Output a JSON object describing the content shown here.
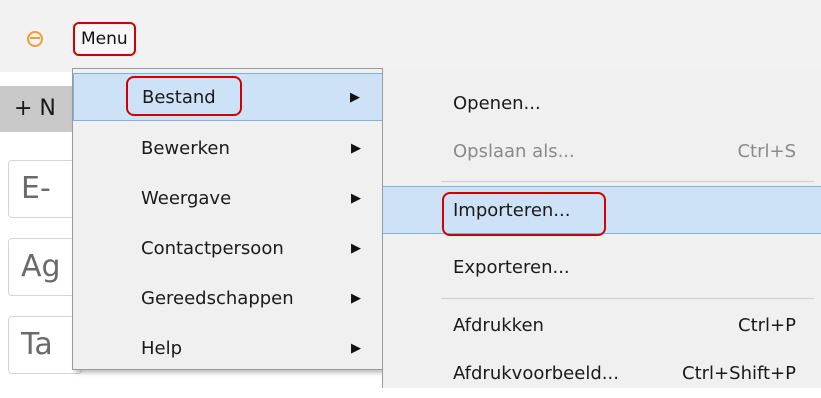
{
  "app": {
    "icon": "mail-app-icon",
    "menu_label": "Menu"
  },
  "toolbar": {
    "new_label": "+ N"
  },
  "sidebar": {
    "tabs": [
      "E-",
      "Ag",
      "Ta"
    ]
  },
  "main_menu": {
    "items": [
      {
        "label": "Bestand",
        "has_submenu": true,
        "selected": true
      },
      {
        "label": "Bewerken",
        "has_submenu": true
      },
      {
        "label": "Weergave",
        "has_submenu": true
      },
      {
        "label": "Contactpersoon",
        "has_submenu": true
      },
      {
        "label": "Gereedschappen",
        "has_submenu": true
      },
      {
        "label": "Help",
        "has_submenu": true
      }
    ],
    "arrow": "▶"
  },
  "file_menu": {
    "items": [
      {
        "label": "Openen...",
        "shortcut": ""
      },
      {
        "label": "Opslaan als...",
        "shortcut": "Ctrl+S",
        "disabled": true
      },
      {
        "label": "Importeren...",
        "shortcut": "",
        "selected": true
      },
      {
        "label": "Exporteren...",
        "shortcut": ""
      },
      {
        "label": "Afdrukken",
        "shortcut": "Ctrl+P"
      },
      {
        "label": "Afdrukvoorbeeld...",
        "shortcut": "Ctrl+Shift+P"
      }
    ]
  },
  "colors": {
    "highlight": "#cde2f7",
    "annotation": "#d40000",
    "menu_bg": "#f0f0f0"
  }
}
